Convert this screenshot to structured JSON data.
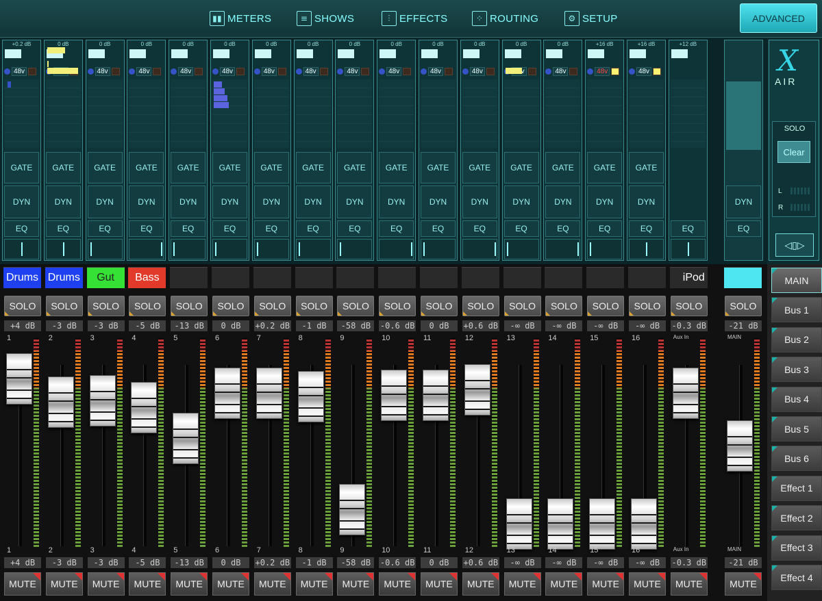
{
  "nav": {
    "meters": "METERS",
    "shows": "SHOWS",
    "effects": "EFFECTS",
    "routing": "ROUTING",
    "setup": "SETUP",
    "advanced": "ADVANCED"
  },
  "upper_labels": {
    "gate": "GATE",
    "dyn": "DYN",
    "eq": "EQ",
    "phantom": "48v"
  },
  "brand": {
    "logo_mark": "X",
    "logo_text": "AIR"
  },
  "solo_panel": {
    "title": "SOLO",
    "clear": "Clear",
    "left": "L",
    "right": "R"
  },
  "channels": [
    {
      "name": "Drums",
      "color": "#1e40f0",
      "top_gain": "+0.2 dB",
      "num": "1",
      "gain": "+4 dB",
      "pan": "center",
      "fader": 0.8
    },
    {
      "name": "Drums",
      "color": "#1e40f0",
      "top_gain": "0 dB",
      "num": "2",
      "gain": "-3 dB",
      "pan": "center",
      "fader": 0.67
    },
    {
      "name": "Gut",
      "color": "#36e136",
      "top_gain": "0 dB",
      "num": "3",
      "gain": "-3 dB",
      "pan": "left",
      "fader": 0.68
    },
    {
      "name": "Bass",
      "color": "#e23a2a",
      "top_gain": "0 dB",
      "num": "4",
      "gain": "-5 dB",
      "pan": "right",
      "fader": 0.64
    },
    {
      "name": "",
      "color": "",
      "top_gain": "0 dB",
      "num": "5",
      "gain": "-13 dB",
      "pan": "left",
      "fader": 0.47
    },
    {
      "name": "",
      "color": "",
      "top_gain": "0 dB",
      "num": "6",
      "gain": "0 dB",
      "pan": "left",
      "fader": 0.72
    },
    {
      "name": "",
      "color": "",
      "top_gain": "0 dB",
      "num": "7",
      "gain": "+0.2 dB",
      "pan": "left",
      "fader": 0.72
    },
    {
      "name": "",
      "color": "",
      "top_gain": "0 dB",
      "num": "8",
      "gain": "-1 dB",
      "pan": "left",
      "fader": 0.7
    },
    {
      "name": "",
      "color": "",
      "top_gain": "0 dB",
      "num": "9",
      "gain": "-58 dB",
      "pan": "left",
      "fader": 0.08
    },
    {
      "name": "",
      "color": "",
      "top_gain": "0 dB",
      "num": "10",
      "gain": "-0.6 dB",
      "pan": "right",
      "fader": 0.71
    },
    {
      "name": "",
      "color": "",
      "top_gain": "0 dB",
      "num": "11",
      "gain": "0 dB",
      "pan": "left",
      "fader": 0.71
    },
    {
      "name": "",
      "color": "",
      "top_gain": "0 dB",
      "num": "12",
      "gain": "+0.6 dB",
      "pan": "right",
      "fader": 0.74
    },
    {
      "name": "",
      "color": "",
      "top_gain": "0 dB",
      "num": "13",
      "gain": "-∞ dB",
      "pan": "left",
      "fader": 0.0
    },
    {
      "name": "",
      "color": "",
      "top_gain": "0 dB",
      "num": "14",
      "gain": "-∞ dB",
      "pan": "right",
      "fader": 0.0
    },
    {
      "name": "",
      "color": "",
      "top_gain": "+16 dB",
      "num": "15",
      "gain": "-∞ dB",
      "pan": "left",
      "fader": 0.0
    },
    {
      "name": "",
      "color": "",
      "top_gain": "+16 dB",
      "num": "16",
      "gain": "-∞ dB",
      "pan": "center",
      "fader": 0.0
    },
    {
      "name": "iPod",
      "color": "",
      "top_gain": "+12 dB",
      "num": "Aux In",
      "gain": "-0.3 dB",
      "pan": "center",
      "fader": 0.72
    }
  ],
  "main_strip": {
    "name": "",
    "num": "MAIN",
    "gain": "-21 dB",
    "fader": 0.43
  },
  "buttons": {
    "solo": "SOLO",
    "mute": "MUTE"
  },
  "buses": [
    "MAIN",
    "Bus 1",
    "Bus 2",
    "Bus 3",
    "Bus 4",
    "Bus 5",
    "Bus 6",
    "Effect 1",
    "Effect 2",
    "Effect 3",
    "Effect 4"
  ]
}
